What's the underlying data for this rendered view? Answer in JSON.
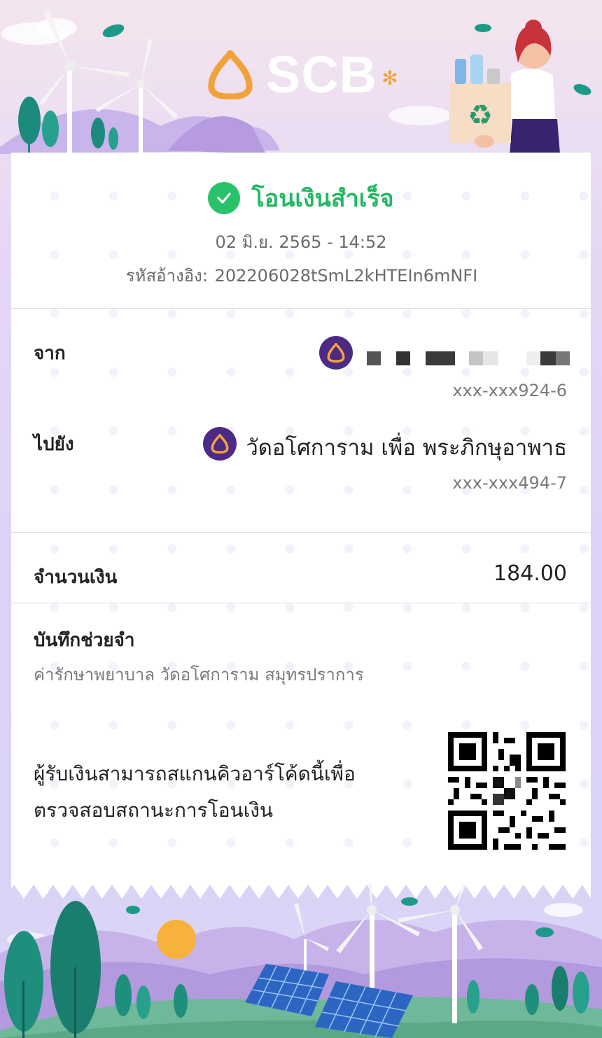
{
  "brand": {
    "name": "SCB",
    "star": "✻"
  },
  "status": {
    "text": "โอนเงินสำเร็จ"
  },
  "datetime": "02 มิ.ย. 2565 - 14:52",
  "reference": {
    "label": "รหัสอ้างอิง:",
    "value": "202206028tSmL2kHTEIn6mNFI"
  },
  "from": {
    "label": "จาก",
    "account": "xxx-xxx924-6"
  },
  "to": {
    "label": "ไปยัง",
    "name": "วัดอโศการาม เพื่อ พระภิกษุอาพาธ",
    "account": "xxx-xxx494-7"
  },
  "amount": {
    "label": "จำนวนเงิน",
    "value": "184.00"
  },
  "memo": {
    "label": "บันทึกช่วยจำ",
    "text": "ค่ารักษาพยาบาล วัดอโศการาม สมุทรปราการ"
  },
  "qr": {
    "line1": "ผู้รับเงินสามารถสแกนคิวอาร์โค้ดนี้เพื่อ",
    "line2": "ตรวจสอบสถานะการโอนเงิน"
  },
  "colors": {
    "success": "#22b862",
    "brand_purple": "#4c2a86",
    "brand_gold": "#f2a23a"
  },
  "icons": [
    "scb-logo-icon",
    "check-circle-icon",
    "qr-code"
  ]
}
